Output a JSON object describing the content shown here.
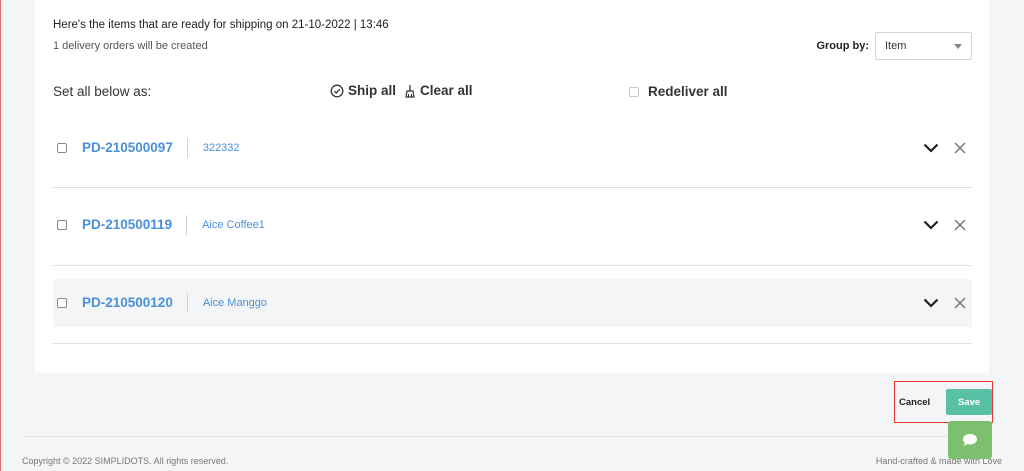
{
  "header": {
    "title": "Here's the items that are ready for shipping on 21-10-2022 | 13:46",
    "subtitle": "1 delivery orders will be created"
  },
  "group_by": {
    "label": "Group by:",
    "selected": "Item"
  },
  "bulk": {
    "set_all_label": "Set all below as:",
    "ship_all": "Ship all",
    "clear_all": "Clear all",
    "redeliver_all": "Redeliver all"
  },
  "rows": [
    {
      "id": "PD-210500097",
      "name": "322332"
    },
    {
      "id": "PD-210500119",
      "name": "Aice Coffee1"
    },
    {
      "id": "PD-210500120",
      "name": "Aice Manggo"
    }
  ],
  "actions": {
    "cancel": "Cancel",
    "save": "Save"
  },
  "footer": {
    "copyright": "Copyright © 2022 SIMPLIDOTS. All rights reserved.",
    "handcrafted": "Hand-crafted & made with Love"
  },
  "colors": {
    "link": "#4a90d9",
    "save": "#58c0a5",
    "chat": "#7cc06d",
    "highlight": "#e53935"
  },
  "icons": {
    "ship_all": "circle-check-icon",
    "clear_all": "broom-icon",
    "expand": "chevron-down-icon",
    "remove": "close-icon",
    "chat": "chat-bubble-icon"
  }
}
